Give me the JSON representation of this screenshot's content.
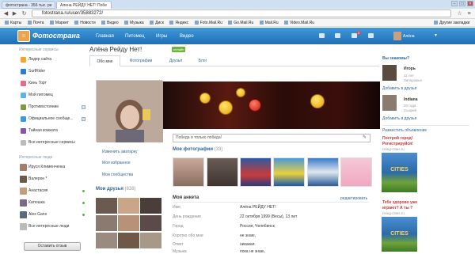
{
  "browser": {
    "tabs": [
      {
        "label": "фотострана - 356 тыс. ре"
      },
      {
        "label": "Алена РЕЙДУ НЕТ! Побе"
      }
    ],
    "url": "fotostrana.ru/user/35883272/",
    "bookmarks": [
      "Карты",
      "Почта",
      "Маркет",
      "Новости",
      "Видео",
      "Музыка",
      "Диск",
      "Яндекс",
      "Foto.Mail.Ru",
      "Go.Mail.Ru",
      "Mail.Ru",
      "Video.Mail.Ru"
    ],
    "other_bookmarks": "Другие закладки"
  },
  "site": {
    "logo": "Фотострана",
    "nav": [
      "Главная",
      "Питомец",
      "Игры",
      "Видео"
    ],
    "notif_count": "2",
    "user": "Алёна"
  },
  "sidebar": {
    "services_title": "Интересные сервисы",
    "services": [
      {
        "label": "Лидер сайта",
        "color": "#f5a623"
      },
      {
        "label": "SurfRider",
        "color": "#2b7cd3"
      },
      {
        "label": "Кинь Торт",
        "color": "#e86a8a"
      },
      {
        "label": "Мой питомец",
        "color": "#5db3f0"
      },
      {
        "label": "Противостояние",
        "color": "#7a9c3a"
      },
      {
        "label": "Официальное сообще...",
        "color": "#3b9be0"
      },
      {
        "label": "Тайная комната",
        "color": "#8a4fb3"
      },
      {
        "label": "Все интересные сервисы",
        "color": "#bbbbbb"
      }
    ],
    "people_title": "Интересные люди",
    "people": [
      {
        "label": "Ируся Клименченка",
        "color": "#a67c6a"
      },
      {
        "label": "Валерон *",
        "color": "#6a5a4a"
      },
      {
        "label": "Анастасия",
        "color": "#c4a07a"
      },
      {
        "label": "Катюшка",
        "color": "#7a6a8a"
      },
      {
        "label": "Alex Gans",
        "color": "#5a6a7a"
      },
      {
        "label": "Все интересные люди",
        "color": "#bbbbbb"
      }
    ],
    "feedback": "Оставить отзыв"
  },
  "profile": {
    "name": "Алёна Рейду Нет!",
    "online": "онлайн",
    "tabs": [
      "Обо мне",
      "Фотографии",
      "Друзья",
      "Блог"
    ],
    "status_placeholder": "Победа и только победа!",
    "actions": [
      "Изменить аватарку",
      "Моя избранное",
      "Мои сообщества"
    ],
    "photos_title": "Мое фотографии",
    "photos_count": "(33)",
    "friends_title": "Мои друзья",
    "friends_count": "(838)",
    "anketa_title": "Моя анкета",
    "edit_link": "редактировать",
    "questionnaire": [
      {
        "label": "Имя",
        "value": "Алёна РЕЙДУ НЕТ!"
      },
      {
        "label": "День рождения",
        "value": "22 октября 1999 (Весы), 13 лет"
      },
      {
        "label": "Город",
        "value": "Россия, Челябинск"
      },
      {
        "label": "Коротко обо мне",
        "value": "не знаю,"
      },
      {
        "label": "Ответ",
        "value": "никакая."
      },
      {
        "label": "Музыка",
        "value": "пока не знаю,"
      }
    ]
  },
  "right": {
    "title": "Вы знакомы?",
    "people": [
      {
        "name": "Игорь",
        "info1": "11 лет",
        "info2": "Запорожье"
      },
      {
        "name": "Indiana",
        "info1": "20 года",
        "info2": "Сызрей"
      }
    ],
    "add_friend": "Добавить в друзья",
    "post_ad": "Разместить объявление",
    "ad1_title": "Построй город!",
    "ad1_sub": "Регистрируйся!",
    "ad1_src": "rising-cities.ru",
    "ad1_city": "CITIES",
    "ad2_title": "Тебе здорово уже",
    "ad2_sub": "играют? А ты ?",
    "ad2_src": "rising-cities.ru",
    "ad2_city": "CITIES"
  }
}
